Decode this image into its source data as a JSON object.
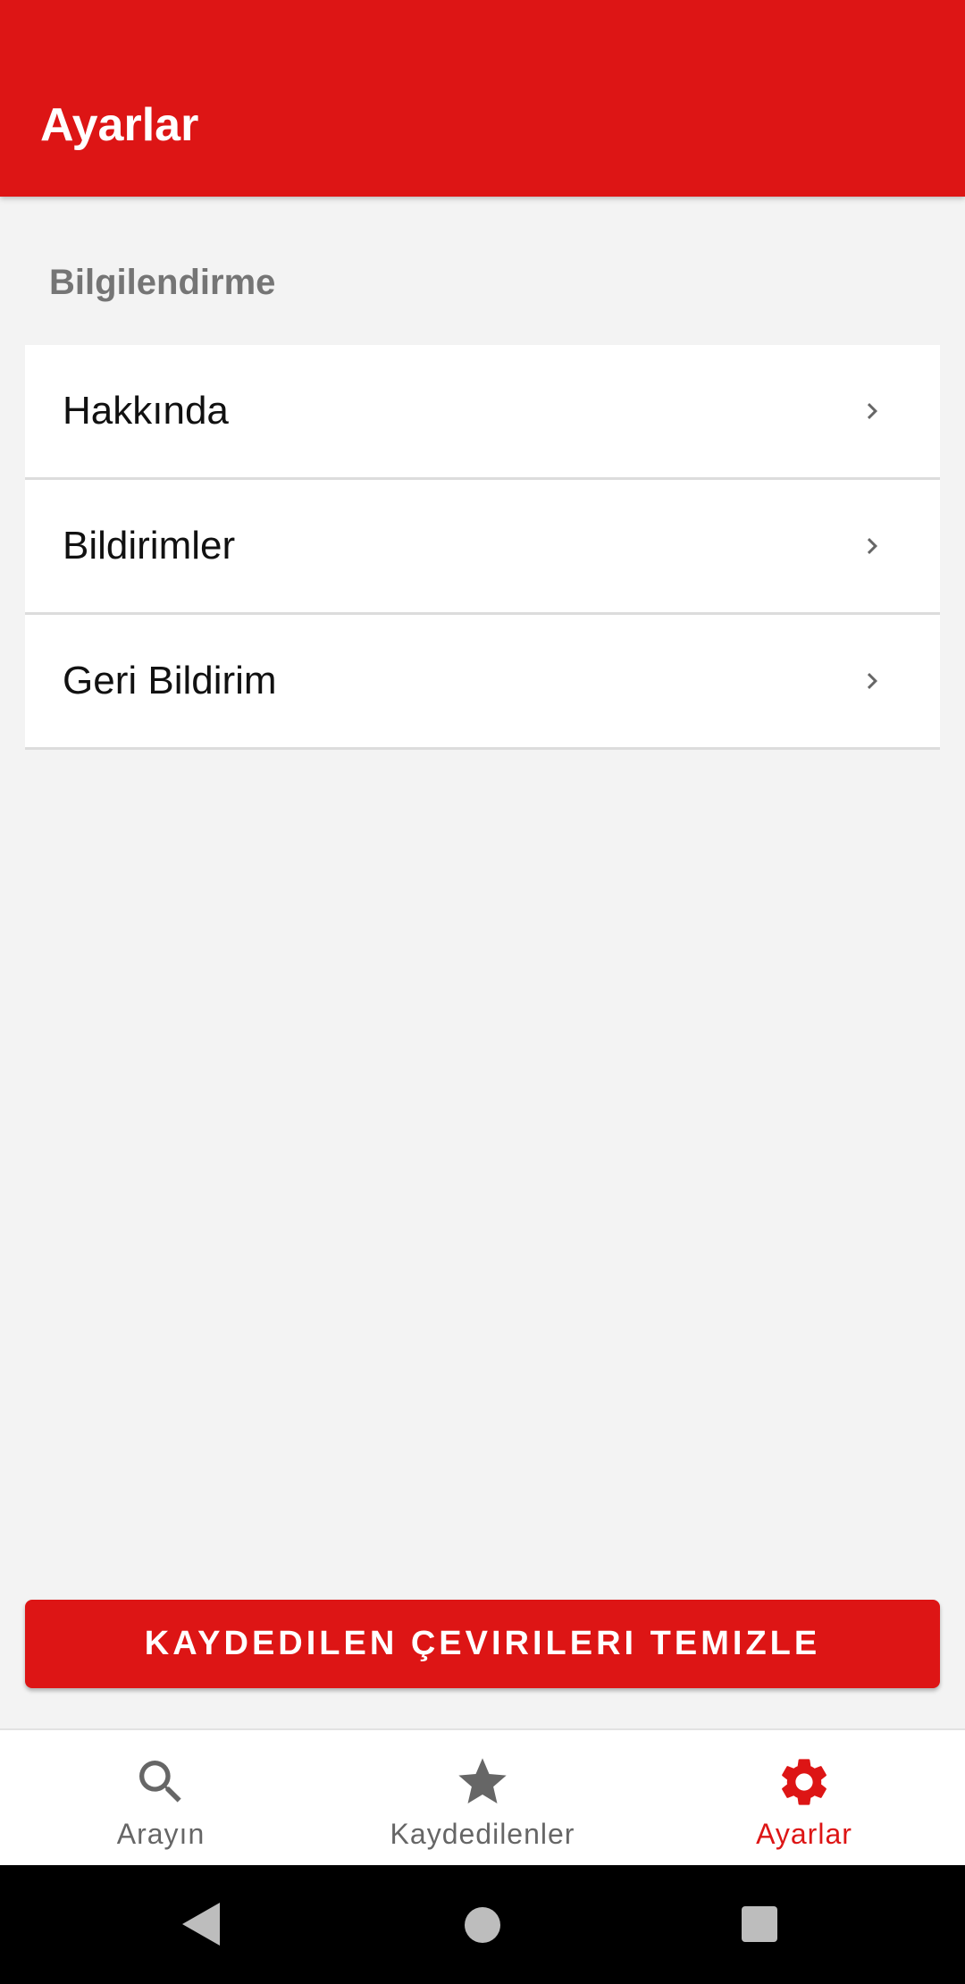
{
  "app_bar": {
    "title": "Ayarlar"
  },
  "section": {
    "header": "Bilgilendirme"
  },
  "settings_items": [
    {
      "label": "Hakkında",
      "icon": "chevron-right-icon"
    },
    {
      "label": "Bildirimler",
      "icon": "chevron-right-icon"
    },
    {
      "label": "Geri Bildirim",
      "icon": "chevron-right-icon"
    }
  ],
  "clear_button": {
    "label": "KAYDEDILEN ÇEVIRILERI TEMIZLE"
  },
  "bottom_nav": {
    "items": [
      {
        "label": "Arayın",
        "icon": "search-icon",
        "active": false
      },
      {
        "label": "Kaydedilenler",
        "icon": "star-icon",
        "active": false
      },
      {
        "label": "Ayarlar",
        "icon": "gear-icon",
        "active": true
      }
    ]
  },
  "system_nav": {
    "buttons": [
      "back-icon",
      "home-icon",
      "recents-icon"
    ]
  },
  "colors": {
    "primary": "#dd1515",
    "background": "#f3f3f3",
    "inactive": "#666666"
  }
}
